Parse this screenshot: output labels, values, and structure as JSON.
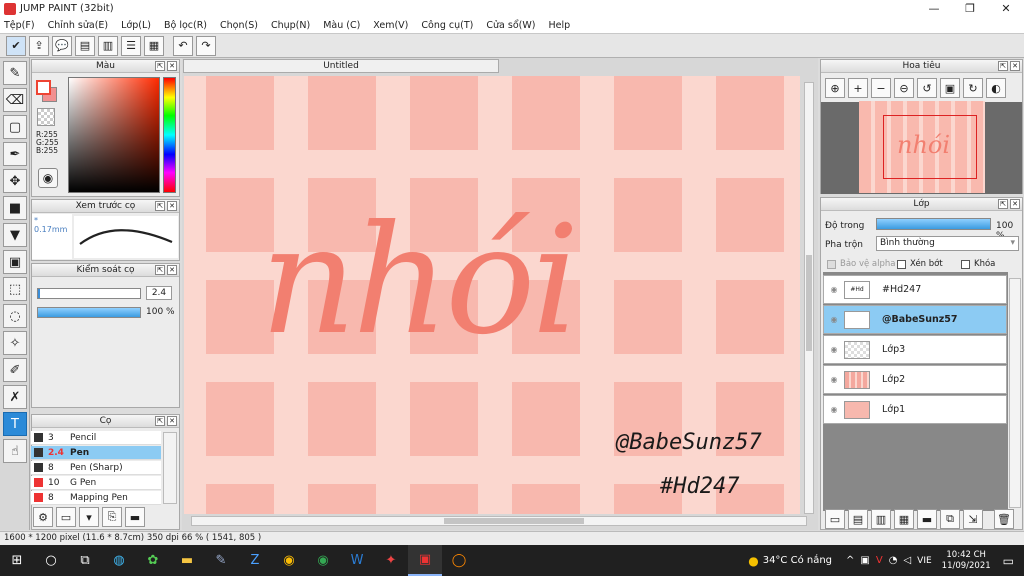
{
  "window": {
    "title": "JUMP PAINT (32bit)",
    "controls": [
      "—",
      "❐",
      "✕"
    ]
  },
  "menu": [
    "Tệp(F)",
    "Chỉnh sửa(E)",
    "Lớp(L)",
    "Bộ lọc(R)",
    "Chọn(S)",
    "Chụp(N)",
    "Màu (C)",
    "Xem(V)",
    "Công cụ(T)",
    "Cửa sổ(W)",
    "Help"
  ],
  "color_panel": {
    "title": "Màu",
    "r": "R:255",
    "g": "G:255",
    "b": "B:255"
  },
  "brush_preview": {
    "title": "Xem trước cọ",
    "size": "* 0.17mm"
  },
  "brush_control": {
    "title": "Kiểm soát cọ",
    "size_value": "2.4",
    "opacity_value": "100 %"
  },
  "brush_list": {
    "title": "Cọ",
    "items": [
      {
        "size": "3",
        "name": "Pencil",
        "selected": false
      },
      {
        "size": "2.4",
        "name": "Pen",
        "selected": true
      },
      {
        "size": "8",
        "name": "Pen (Sharp)",
        "selected": false
      },
      {
        "size": "10",
        "name": "G Pen",
        "selected": false
      },
      {
        "size": "8",
        "name": "Mapping Pen",
        "selected": false
      }
    ]
  },
  "document": {
    "tab_title": "Untitled"
  },
  "canvas_art": {
    "main_word": "nhói",
    "credit_line1": "@BabeSunz57",
    "credit_line2": "#Hd247"
  },
  "navigator": {
    "title": "Hoa tiêu",
    "thumb_text": "nhói"
  },
  "layers": {
    "title": "Lớp",
    "opacity_label": "Độ trong",
    "opacity_value": "100 %",
    "blend_label": "Pha trộn",
    "blend_value": "Bình thường",
    "protect_alpha": "Bảo vệ alpha",
    "clipping": "Xén bớt",
    "lock": "Khóa",
    "items": [
      {
        "name": "#Hd247",
        "selected": false
      },
      {
        "name": "@BabeSunz57",
        "selected": true
      },
      {
        "name": "Lớp3",
        "selected": false
      },
      {
        "name": "Lớp2",
        "selected": false
      },
      {
        "name": "Lớp1",
        "selected": false
      }
    ]
  },
  "status": {
    "text": "1600 * 1200 pixel   (11.6 * 8.7cm)   350 dpi   66 %   ( 1541, 805 )"
  },
  "taskbar": {
    "weather": "34°C  Có nắng",
    "lang": "VIE",
    "time": "10:42 CH",
    "date": "11/09/2021"
  },
  "colors": {
    "canvas_bg": "#fbd7cf",
    "grid_square": "#f8b8ae",
    "lettering": "#f27f70",
    "accent": "#2b8ad8"
  }
}
